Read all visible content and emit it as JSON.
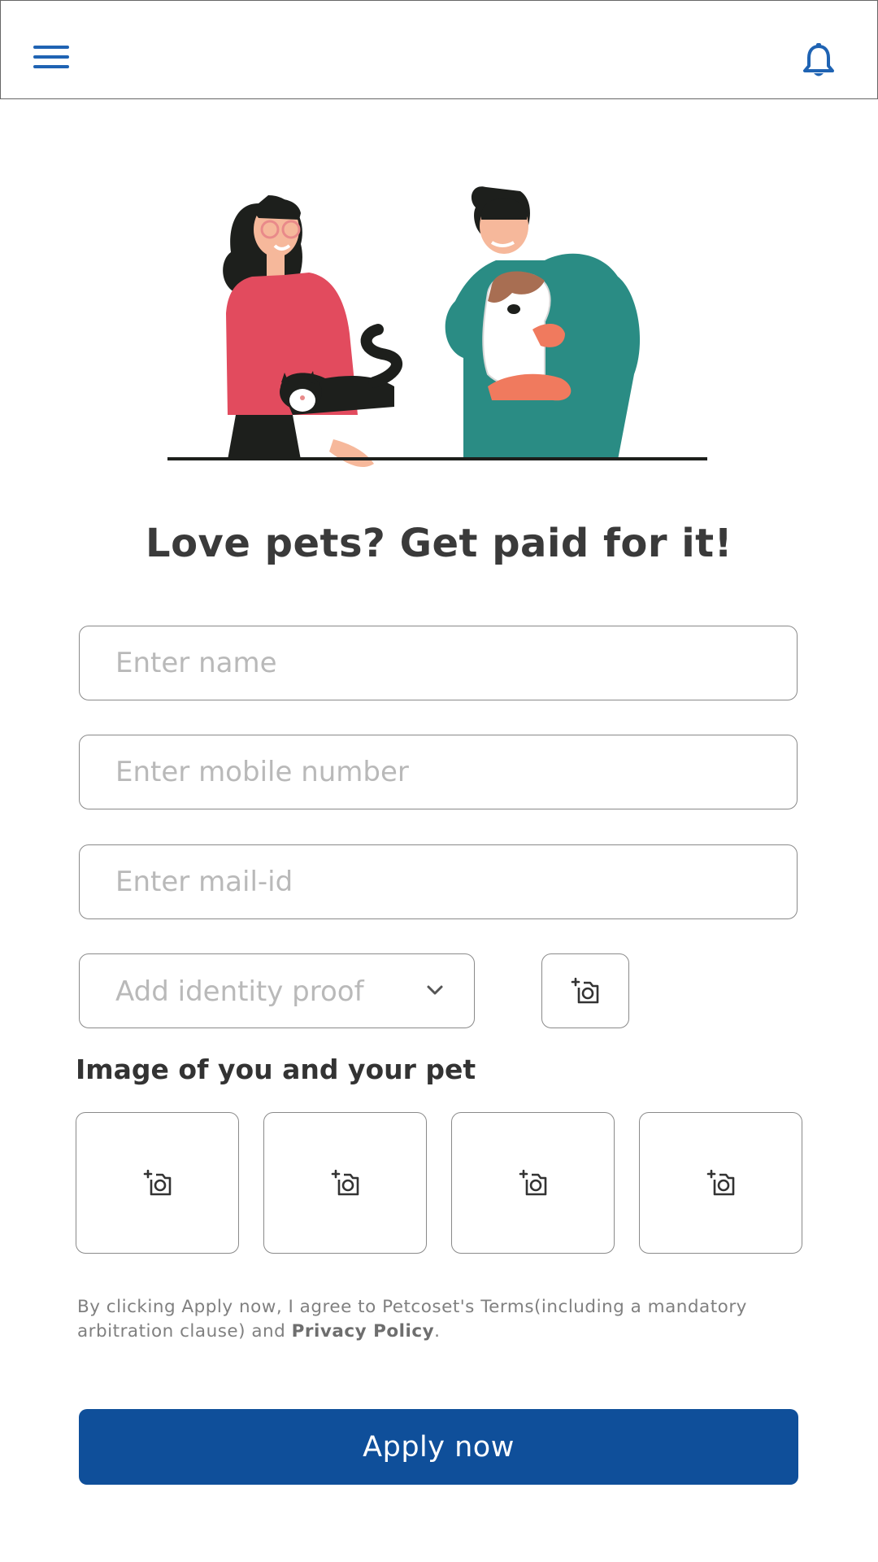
{
  "header": {
    "menu_icon": "hamburger-menu-icon",
    "notification_icon": "bell-icon",
    "accent_color": "#1f63b3"
  },
  "hero": {
    "illustration": "people-holding-cat-and-dog"
  },
  "title": "Love pets? Get paid for it!",
  "form": {
    "name_placeholder": "Enter name",
    "mobile_placeholder": "Enter mobile number",
    "email_placeholder": "Enter mail-id",
    "identity_select": "Add identity proof",
    "identity_upload_icon": "add-photo-icon",
    "pet_images_heading": "Image of you and your pet",
    "pet_image_slots": 4
  },
  "terms": {
    "text_before": "By clicking Apply now, I agree to Petcoset's Terms(including a mandatory arbitration clause) and ",
    "link": "Privacy Policy",
    "text_after": "."
  },
  "apply_button": {
    "label": "Apply now",
    "color": "#0f4f9a"
  }
}
